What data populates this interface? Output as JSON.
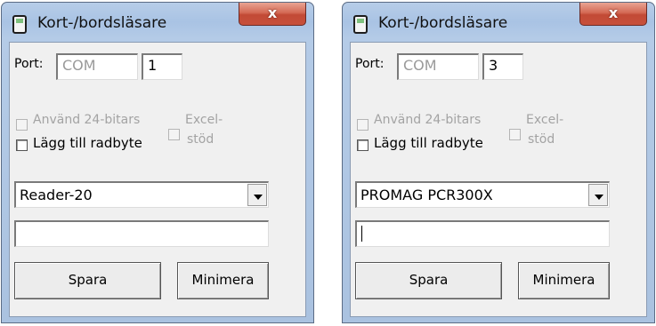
{
  "windows": [
    {
      "title": "Kort-/bordsläsare",
      "close_label": "x",
      "port_label": "Port:",
      "port_prefix": "COM",
      "port_number": "1",
      "use24_label_line1": "Använd 24-bitars",
      "excel_label_line1": "Excel-",
      "excel_label_line2": "stöd",
      "newline_label": "Lägg till radbyte",
      "reader_selected": "Reader-20",
      "input_value": "",
      "save_label": "Spara",
      "minimize_label": "Minimera"
    },
    {
      "title": "Kort-/bordsläsare",
      "close_label": "x",
      "port_label": "Port:",
      "port_prefix": "COM",
      "port_number": "3",
      "use24_label_line1": "Använd 24-bitars",
      "excel_label_line1": "Excel-",
      "excel_label_line2": "stöd",
      "newline_label": "Lägg till radbyte",
      "reader_selected": "PROMAG PCR300X",
      "input_value": "",
      "save_label": "Spara",
      "minimize_label": "Minimera"
    }
  ],
  "colors": {
    "title_bar": "#b4cbe7",
    "close_button": "#c7503c",
    "client_bg": "#f0f0f0"
  },
  "icons": {
    "app": "card-reader-icon",
    "close": "close-icon",
    "dropdown": "chevron-down-icon"
  }
}
